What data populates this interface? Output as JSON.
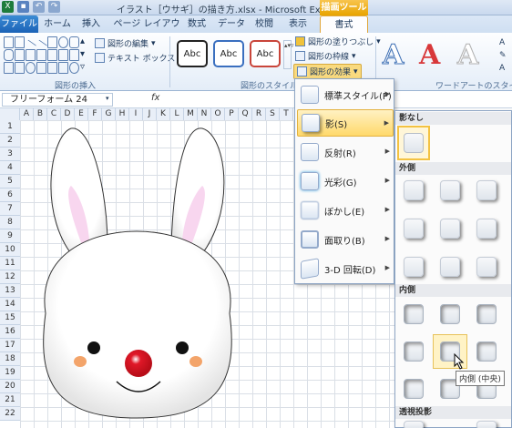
{
  "window": {
    "title": "イラスト［ウサギ］の描き方.xlsx - Microsoft Excel",
    "context_tab_title": "描画ツール"
  },
  "tabs": [
    {
      "label": "ファイル"
    },
    {
      "label": "ホーム"
    },
    {
      "label": "挿入"
    },
    {
      "label": "ページ レイアウト"
    },
    {
      "label": "数式"
    },
    {
      "label": "データ"
    },
    {
      "label": "校閲"
    },
    {
      "label": "表示"
    },
    {
      "label": "書式"
    }
  ],
  "ribbon": {
    "edit_shape": "図形の編集",
    "text_box": "テキスト ボックス",
    "insert_shapes_group": "図形の挿入",
    "style_sample": "Abc",
    "shape_styles_group": "図形のスタイル",
    "shape_fill": "図形の塗りつぶし",
    "shape_outline": "図形の枠線",
    "shape_effects": "図形の効果",
    "wordart_sample": "A",
    "wordart_group": "ワードアートのスタイル"
  },
  "formula_bar": {
    "name_box": "フリーフォーム 24",
    "fx": "fx"
  },
  "columns": [
    "A",
    "B",
    "C",
    "D",
    "E",
    "F",
    "G",
    "H",
    "I",
    "J",
    "K",
    "L",
    "M",
    "N",
    "O",
    "P",
    "Q",
    "R",
    "S",
    "T"
  ],
  "rows": [
    "1",
    "2",
    "3",
    "4",
    "5",
    "6",
    "7",
    "8",
    "9",
    "10",
    "11",
    "12",
    "13",
    "14",
    "15",
    "16",
    "17",
    "18",
    "19",
    "20",
    "21",
    "22"
  ],
  "effects_menu": [
    {
      "label": "標準スタイル(P)"
    },
    {
      "label": "影(S)"
    },
    {
      "label": "反射(R)"
    },
    {
      "label": "光彩(G)"
    },
    {
      "label": "ぼかし(E)"
    },
    {
      "label": "面取り(B)"
    },
    {
      "label": "3-D 回転(D)"
    }
  ],
  "shadow_submenu": {
    "no_shadow": "影なし",
    "outer": "外側",
    "inner": "内側",
    "perspective": "透視投影"
  },
  "tooltip": "内側 (中央)",
  "colors": {
    "accent": "#1c63b7",
    "highlight": "#ffd96b",
    "nose": "#d81020",
    "cheek": "#f29a5a",
    "ear_inner": "#f8d6ef"
  }
}
